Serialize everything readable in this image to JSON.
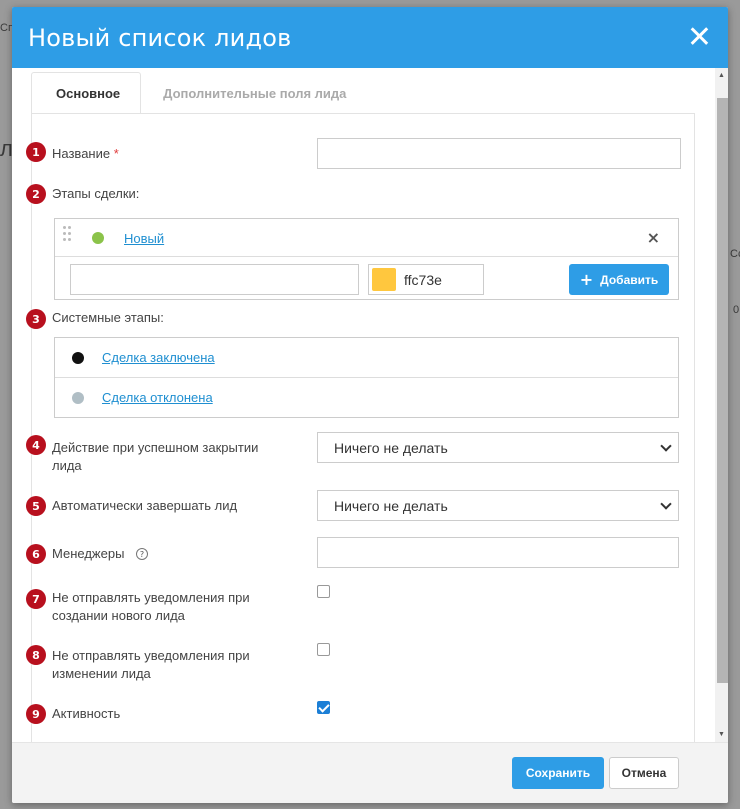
{
  "background": {
    "fragments": [
      "Сп",
      "л",
      "Сс",
      "0"
    ]
  },
  "modal": {
    "title": "Новый список лидов",
    "close_icon": "close-icon"
  },
  "tabs": [
    {
      "label": "Основное",
      "active": true
    },
    {
      "label": "Дополнительные поля лида",
      "active": false
    }
  ],
  "form": {
    "fields": [
      {
        "num": "1",
        "label": "Название",
        "required_mark": "*",
        "value": ""
      },
      {
        "num": "2",
        "label": "Этапы сделки:"
      },
      {
        "num": "3",
        "label": "Системные этапы:"
      },
      {
        "num": "4",
        "label_line1": "Действие при успешном закрытии",
        "label_line2": "лида",
        "value": "Ничего не делать"
      },
      {
        "num": "5",
        "label": "Автоматически завершать лид",
        "value": "Ничего не делать"
      },
      {
        "num": "6",
        "label": "Менеджеры",
        "help_icon": "question-icon",
        "value": ""
      },
      {
        "num": "7",
        "label_line1": "Не отправлять уведомления при",
        "label_line2": "создании нового лида",
        "checked": false
      },
      {
        "num": "8",
        "label_line1": "Не отправлять уведомления при",
        "label_line2": "изменении лида",
        "checked": false
      },
      {
        "num": "9",
        "label": "Активность",
        "checked": true
      }
    ],
    "deal_stages": [
      {
        "name": "Новый",
        "color": "#8bc34a"
      }
    ],
    "new_stage": {
      "name_value": "",
      "color_value": "ffc73e",
      "color_swatch": "#ffc73e",
      "add_label": "Добавить"
    },
    "system_stages": [
      {
        "name": "Сделка заключена",
        "color": "#111111"
      },
      {
        "name": "Сделка отклонена",
        "color": "#b0bec5"
      }
    ]
  },
  "footer": {
    "save_label": "Сохранить",
    "cancel_label": "Отмена"
  },
  "colors": {
    "accent": "#2e9de6",
    "badge": "#b8101e",
    "link": "#1f8fd1"
  }
}
